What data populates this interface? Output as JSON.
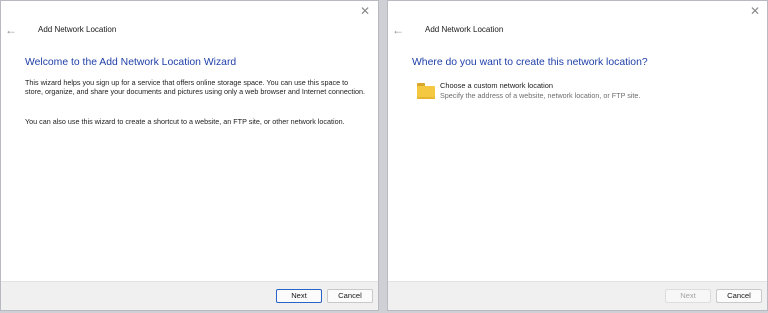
{
  "left_window": {
    "title": "Add Network Location",
    "heading": "Welcome to the Add Network Location Wizard",
    "paragraph1": "This wizard helps you sign up for a service that offers online storage space.  You can use this space to store, organize, and share your documents and pictures using only a web browser and Internet connection.",
    "paragraph2": "You can also use this wizard to create a shortcut to a website, an FTP site, or other network location.",
    "next_label": "Next",
    "cancel_label": "Cancel"
  },
  "right_window": {
    "title": "Add Network Location",
    "heading": "Where do you want to create this network location?",
    "option_title": "Choose a custom network location",
    "option_desc": "Specify the address of a website, network location, or FTP site.",
    "next_label": "Next",
    "cancel_label": "Cancel",
    "next_enabled": false
  },
  "icons": {
    "back": "back-arrow-icon",
    "close": "close-icon",
    "folder": "folder-icon"
  },
  "colors": {
    "heading": "#1f3fa8",
    "folder": "#f5c842",
    "focus_border": "#2a63c7"
  }
}
